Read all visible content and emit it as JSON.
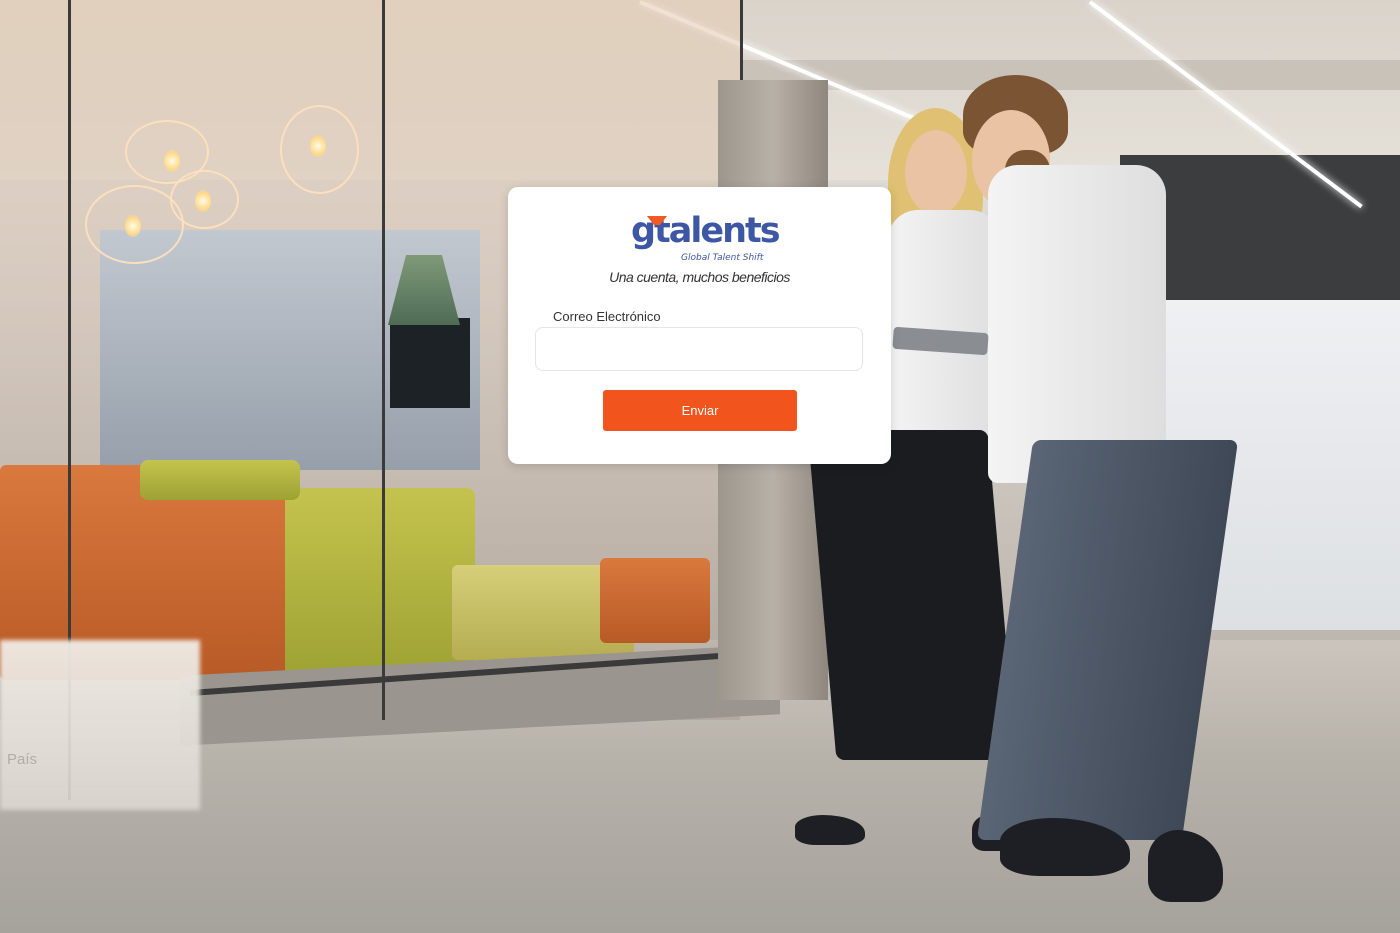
{
  "brand": {
    "logo_text": "gtalents",
    "logo_subtitle": "Global Talent Shift",
    "tagline": "Una cuenta, muchos beneficios",
    "primary_color": "#3e57a5",
    "accent_color": "#f2541e"
  },
  "form": {
    "email_label": "Correo Electrónico",
    "email_value": "",
    "email_placeholder": "",
    "submit_label": "Enviar"
  },
  "background": {
    "country_label": "País",
    "photo_subject": "office-scene-two-people-with-tablet"
  }
}
